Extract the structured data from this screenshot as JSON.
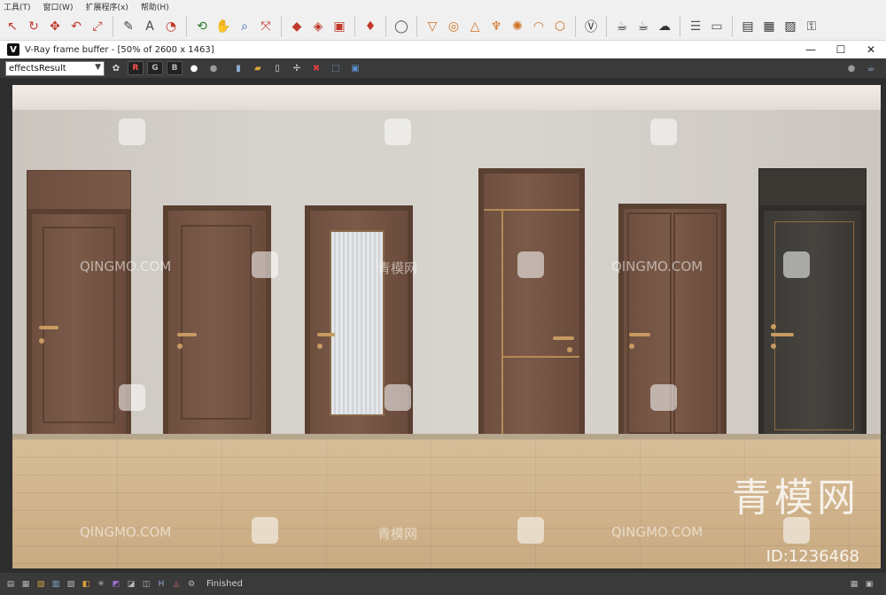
{
  "host_app": {
    "menu": [
      "工具(T)",
      "窗口(W)",
      "扩展程序(x)",
      "帮助(H)"
    ],
    "toolbar_icons": [
      {
        "name": "select-icon",
        "glyph": "↖"
      },
      {
        "name": "rotate-icon",
        "glyph": "↻"
      },
      {
        "name": "move-icon",
        "glyph": "✥"
      },
      {
        "name": "undo-icon",
        "glyph": "↶"
      },
      {
        "name": "scale-icon",
        "glyph": "⤢"
      },
      {
        "name": "paint-icon",
        "glyph": "✎"
      },
      {
        "name": "text-icon",
        "glyph": "A"
      },
      {
        "name": "tape-icon",
        "glyph": "◔"
      },
      {
        "name": "orbit-icon",
        "glyph": "⟲"
      },
      {
        "name": "pan-icon",
        "glyph": "✋"
      },
      {
        "name": "zoom-icon",
        "glyph": "⌕"
      },
      {
        "name": "zoom-extents-icon",
        "glyph": "⤧"
      },
      {
        "name": "component-icon",
        "glyph": "◆"
      },
      {
        "name": "material-icon",
        "glyph": "◈"
      },
      {
        "name": "warehouse-icon",
        "glyph": "▣"
      },
      {
        "name": "ruby-icon",
        "glyph": "♦"
      },
      {
        "name": "user-icon",
        "glyph": "◯"
      },
      {
        "name": "light-icon",
        "glyph": "▽"
      },
      {
        "name": "sphere-light-icon",
        "glyph": "◎"
      },
      {
        "name": "spot-icon",
        "glyph": "△"
      },
      {
        "name": "ies-icon",
        "glyph": "♆"
      },
      {
        "name": "sun-icon",
        "glyph": "✺"
      },
      {
        "name": "dome-icon",
        "glyph": "◠"
      },
      {
        "name": "proxy-icon",
        "glyph": "⬡"
      },
      {
        "name": "vray-logo-icon",
        "glyph": "Ⓥ"
      },
      {
        "name": "teapot-icon",
        "glyph": "☕"
      },
      {
        "name": "render-icon",
        "glyph": "☕"
      },
      {
        "name": "cloud-icon",
        "glyph": "☁"
      },
      {
        "name": "batch-icon",
        "glyph": "☰"
      },
      {
        "name": "frame-icon",
        "glyph": "▭"
      },
      {
        "name": "window-icon",
        "glyph": "▤"
      },
      {
        "name": "vfb-icon",
        "glyph": "▦"
      },
      {
        "name": "image-icon",
        "glyph": "▨"
      },
      {
        "name": "lock-icon",
        "glyph": "⚿"
      }
    ]
  },
  "vfb": {
    "title": "V-Ray frame buffer - [50% of 2600 x 1463]",
    "logo": "V",
    "window_buttons": {
      "minimize": "—",
      "maximize": "☐",
      "close": "✕"
    },
    "channel": "effectsResult",
    "channel_buttons": [
      "R",
      "G",
      "B"
    ],
    "toolbar_icons": [
      {
        "name": "white-dot-icon",
        "glyph": "●"
      },
      {
        "name": "gray-dot-icon",
        "glyph": "●"
      },
      {
        "name": "save-icon",
        "glyph": "▮"
      },
      {
        "name": "open-icon",
        "glyph": "▰"
      },
      {
        "name": "clipboard-icon",
        "glyph": "▯"
      },
      {
        "name": "track-mouse-icon",
        "glyph": "✢"
      },
      {
        "name": "clear-icon",
        "glyph": "✖"
      },
      {
        "name": "render-region-icon",
        "glyph": "⬚"
      },
      {
        "name": "display-icon",
        "glyph": "▣"
      }
    ],
    "toolbar_right_icons": [
      {
        "name": "sphere-icon",
        "glyph": "●"
      },
      {
        "name": "teapot-render-icon",
        "glyph": "☕"
      }
    ]
  },
  "render": {
    "watermark_site": "QINGMO.COM",
    "watermark_cn": "青模网",
    "watermark_big": "青模网",
    "watermark_id": "ID:1236468"
  },
  "statusbar": {
    "icons": [
      {
        "name": "history-icon",
        "glyph": "▤"
      },
      {
        "name": "lens-icon",
        "glyph": "▦"
      },
      {
        "name": "color-icon",
        "glyph": "▧"
      },
      {
        "name": "levels-icon",
        "glyph": "▥"
      },
      {
        "name": "curves-icon",
        "glyph": "▨"
      },
      {
        "name": "exposure-icon",
        "glyph": "◧"
      },
      {
        "name": "white-balance-icon",
        "glyph": "✳"
      },
      {
        "name": "hsl-icon",
        "glyph": "◩"
      },
      {
        "name": "lut-icon",
        "glyph": "◪"
      },
      {
        "name": "ocio-icon",
        "glyph": "◫"
      },
      {
        "name": "h-icon",
        "glyph": "H"
      },
      {
        "name": "stamp-icon",
        "glyph": "◬"
      },
      {
        "name": "settings-icon",
        "glyph": "⚙"
      }
    ],
    "status": "Finished",
    "right_icons": [
      {
        "name": "pin-icon",
        "glyph": "▦"
      },
      {
        "name": "info-icon",
        "glyph": "▣"
      }
    ]
  }
}
